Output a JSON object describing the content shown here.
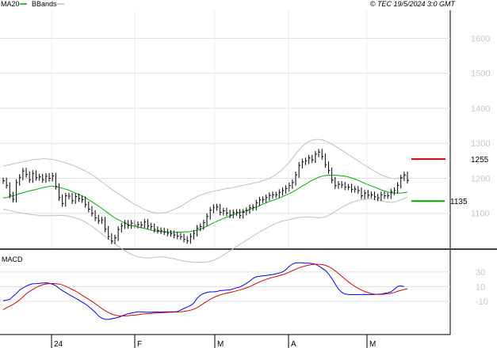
{
  "header": {
    "timestamp": "© TEC 19/5/2024 3:0 GMT"
  },
  "price_panel": {
    "legend": [
      {
        "label": "MA20",
        "color": "#00a000"
      },
      {
        "label": "BBands",
        "color": "#bfbfbf"
      }
    ]
  },
  "macd_panel": {
    "title": "MACD"
  },
  "colors": {
    "price_bar": "#000000",
    "ma20": "#00b000",
    "bbands": "#bfbfbf",
    "resistance": "#d00000",
    "support": "#00a000",
    "macd": "#0000ff",
    "signal": "#e00000",
    "grid": "#e0e0e0",
    "frame": "#000000",
    "axis_label": "#c8c8c8"
  },
  "chart_data": [
    {
      "type": "ohlc",
      "name": "price",
      "ylim": [
        1000,
        1680
      ],
      "y_ticks": [
        1100,
        1200,
        1300,
        1400,
        1500,
        1600
      ],
      "x_labels": [
        "24",
        "F",
        "M",
        "A",
        "M"
      ],
      "x_label_positions": [
        0,
        24,
        49,
        72,
        98
      ],
      "n_bars": 124,
      "close": [
        1193,
        1180,
        1152,
        1140,
        1188,
        1203,
        1221,
        1211,
        1196,
        1214,
        1202,
        1204,
        1196,
        1206,
        1200,
        1207,
        1177,
        1145,
        1128,
        1150,
        1149,
        1136,
        1148,
        1142,
        1139,
        1125,
        1112,
        1100,
        1087,
        1079,
        1081,
        1055,
        1034,
        1021,
        1030,
        1054,
        1064,
        1072,
        1065,
        1072,
        1066,
        1068,
        1067,
        1075,
        1064,
        1062,
        1054,
        1051,
        1050,
        1047,
        1043,
        1042,
        1038,
        1035,
        1033,
        1026,
        1022,
        1034,
        1043,
        1058,
        1062,
        1073,
        1091,
        1109,
        1117,
        1118,
        1103,
        1107,
        1101,
        1095,
        1102,
        1103,
        1094,
        1103,
        1108,
        1116,
        1117,
        1130,
        1138,
        1139,
        1145,
        1151,
        1153,
        1153,
        1160,
        1165,
        1171,
        1179,
        1188,
        1210,
        1237,
        1247,
        1250,
        1258,
        1253,
        1269,
        1275,
        1262,
        1239,
        1222,
        1195,
        1179,
        1183,
        1181,
        1175,
        1175,
        1168,
        1169,
        1165,
        1150,
        1158,
        1152,
        1153,
        1147,
        1144,
        1153,
        1150,
        1150,
        1161,
        1165,
        1180,
        1201,
        1210,
        1194
      ],
      "ma20": [
        1144,
        1145,
        1148,
        1150,
        1153,
        1156,
        1159,
        1161,
        1164,
        1166,
        1168,
        1171,
        1173,
        1175,
        1177,
        1178,
        1176,
        1174,
        1172,
        1169,
        1166,
        1162,
        1158,
        1154,
        1150,
        1145,
        1139,
        1133,
        1127,
        1121,
        1114,
        1107,
        1100,
        1093,
        1087,
        1082,
        1077,
        1072,
        1068,
        1065,
        1063,
        1061,
        1059,
        1057,
        1055,
        1052,
        1050,
        1049,
        1048,
        1047,
        1047,
        1047,
        1046,
        1046,
        1046,
        1047,
        1047,
        1048,
        1050,
        1052,
        1055,
        1059,
        1063,
        1068,
        1073,
        1077,
        1081,
        1085,
        1089,
        1092,
        1096,
        1099,
        1102,
        1105,
        1108,
        1111,
        1115,
        1118,
        1122,
        1126,
        1130,
        1134,
        1137,
        1140,
        1144,
        1148,
        1152,
        1156,
        1161,
        1166,
        1172,
        1178,
        1183,
        1189,
        1194,
        1199,
        1203,
        1206,
        1208,
        1209,
        1209,
        1209,
        1208,
        1207,
        1206,
        1204,
        1201,
        1198,
        1194,
        1190,
        1186,
        1182,
        1178,
        1175,
        1171,
        1167,
        1164,
        1161,
        1159,
        1158,
        1158,
        1158,
        1159,
        1161
      ],
      "bb_upper": [
        1235,
        1237,
        1239,
        1241,
        1243,
        1245,
        1247,
        1249,
        1251,
        1253,
        1254,
        1255,
        1256,
        1256,
        1255,
        1254,
        1252,
        1250,
        1247,
        1244,
        1241,
        1238,
        1234,
        1230,
        1226,
        1221,
        1216,
        1210,
        1204,
        1197,
        1190,
        1183,
        1176,
        1169,
        1162,
        1156,
        1150,
        1144,
        1138,
        1132,
        1126,
        1121,
        1116,
        1111,
        1107,
        1104,
        1102,
        1101,
        1101,
        1102,
        1104,
        1107,
        1111,
        1115,
        1120,
        1126,
        1132,
        1138,
        1143,
        1148,
        1152,
        1155,
        1158,
        1161,
        1163,
        1165,
        1167,
        1169,
        1171,
        1172,
        1174,
        1176,
        1178,
        1180,
        1182,
        1184,
        1186,
        1188,
        1190,
        1193,
        1196,
        1200,
        1205,
        1211,
        1218,
        1226,
        1235,
        1246,
        1258,
        1270,
        1281,
        1291,
        1299,
        1305,
        1309,
        1311,
        1311,
        1310,
        1307,
        1303,
        1298,
        1292,
        1286,
        1280,
        1274,
        1268,
        1262,
        1256,
        1250,
        1244,
        1238,
        1232,
        1226,
        1220,
        1215,
        1210,
        1206,
        1203,
        1200,
        1199,
        1200,
        1202,
        1205,
        1208
      ],
      "bb_lower": [
        1112,
        1110,
        1108,
        1106,
        1104,
        1102,
        1100,
        1099,
        1097,
        1096,
        1095,
        1094,
        1093,
        1093,
        1093,
        1094,
        1094,
        1094,
        1094,
        1093,
        1092,
        1090,
        1087,
        1084,
        1080,
        1075,
        1069,
        1063,
        1056,
        1049,
        1041,
        1034,
        1027,
        1020,
        1013,
        1006,
        999,
        993,
        988,
        983,
        979,
        976,
        974,
        973,
        973,
        973,
        974,
        975,
        976,
        975,
        974,
        972,
        970,
        968,
        966,
        964,
        962,
        961,
        960,
        960,
        960,
        960,
        961,
        963,
        966,
        970,
        975,
        981,
        987,
        993,
        999,
        1005,
        1011,
        1017,
        1023,
        1029,
        1035,
        1041,
        1047,
        1052,
        1057,
        1062,
        1067,
        1071,
        1075,
        1078,
        1080,
        1082,
        1084,
        1086,
        1088,
        1089,
        1090,
        1090,
        1089,
        1088,
        1087,
        1088,
        1090,
        1094,
        1099,
        1105,
        1111,
        1117,
        1122,
        1127,
        1131,
        1134,
        1137,
        1139,
        1140,
        1141,
        1141,
        1140,
        1138,
        1136,
        1134,
        1132,
        1131,
        1132,
        1135,
        1139,
        1142,
        1146
      ],
      "annotations": [
        {
          "label": "1255",
          "value": 1255,
          "color": "#d00000"
        },
        {
          "label": "1135",
          "value": 1135,
          "color": "#00a000"
        }
      ]
    },
    {
      "type": "line",
      "name": "MACD",
      "ylim": [
        -55,
        60
      ],
      "y_ticks": [
        30,
        10,
        -10
      ],
      "y_tick_labels": [
        "30",
        "10",
        "-10"
      ],
      "series": [
        {
          "name": "MACD",
          "color": "#0000ff",
          "values": [
            -9.0,
            -8.2,
            -7.3,
            -3.2,
            0.7,
            5.4,
            8.4,
            10.8,
            12.7,
            14.0,
            14.2,
            14.5,
            15.0,
            15.3,
            14.8,
            13.4,
            11.4,
            7.9,
            4.8,
            2.2,
            -0.5,
            -3.1,
            -5.6,
            -8.0,
            -10.8,
            -13.5,
            -16.8,
            -20.7,
            -24.8,
            -29.6,
            -32.6,
            -34.3,
            -34.5,
            -33.5,
            -32.6,
            -31.8,
            -30.0,
            -28.2,
            -26.6,
            -25.7,
            -24.9,
            -24.2,
            -24.1,
            -24.5,
            -24.6,
            -24.7,
            -24.5,
            -24.4,
            -24.3,
            -24.1,
            -24.1,
            -24.1,
            -24.0,
            -23.7,
            -21.8,
            -19.5,
            -17.6,
            -15.6,
            -12.3,
            -5.8,
            -1.5,
            0.8,
            2.3,
            3.0,
            3.1,
            3.5,
            4.8,
            5.1,
            5.5,
            5.7,
            7.0,
            8.6,
            9.6,
            11.9,
            14.5,
            17.6,
            21.3,
            23.6,
            24.1,
            24.9,
            25.2,
            26.0,
            26.6,
            27.7,
            28.6,
            30.1,
            33.1,
            37.5,
            40.8,
            42.5,
            42.6,
            42.5,
            42.1,
            42.0,
            41.5,
            40.6,
            38.2,
            35.2,
            32.3,
            27.3,
            21.3,
            13.9,
            7.0,
            2.4,
            0.2,
            -0.6,
            -0.7,
            -0.7,
            -0.7,
            -0.6,
            -0.5,
            -0.6,
            -0.6,
            -0.6,
            -0.1,
            -0.1,
            1.0,
            1.8,
            3.1,
            6.4,
            10.4,
            11.1,
            10.3
          ]
        },
        {
          "name": "Signal",
          "color": "#e00000",
          "values": [
            -21.2,
            -18.7,
            -16.4,
            -14.2,
            -11.3,
            -7.8,
            -3.9,
            0.4,
            3.6,
            6.4,
            8.8,
            11.0,
            12.7,
            13.7,
            14.2,
            14.3,
            14.2,
            13.6,
            12.5,
            10.7,
            8.6,
            6.3,
            4.0,
            1.4,
            -1.5,
            -4.3,
            -7.1,
            -10.0,
            -13.0,
            -16.2,
            -19.5,
            -22.4,
            -25.0,
            -27.1,
            -28.6,
            -29.4,
            -29.8,
            -29.7,
            -29.5,
            -29.0,
            -28.6,
            -28.0,
            -27.4,
            -27.0,
            -26.5,
            -26.2,
            -25.9,
            -25.7,
            -25.4,
            -25.1,
            -24.9,
            -24.7,
            -24.5,
            -24.3,
            -24.1,
            -23.6,
            -22.9,
            -21.9,
            -20.4,
            -18.3,
            -15.7,
            -12.8,
            -9.9,
            -7.1,
            -4.7,
            -2.8,
            -1.2,
            0.2,
            1.3,
            2.3,
            3.3,
            4.4,
            5.5,
            6.9,
            8.4,
            10.2,
            12.3,
            14.5,
            16.5,
            18.3,
            20.0,
            21.4,
            22.7,
            23.9,
            25.1,
            26.2,
            27.8,
            29.7,
            31.8,
            33.8,
            35.6,
            37.1,
            38.4,
            39.4,
            40.2,
            40.6,
            40.6,
            40.2,
            39.2,
            37.4,
            34.9,
            31.7,
            28.0,
            24.2,
            20.4,
            16.8,
            13.4,
            10.4,
            7.7,
            5.5,
            3.6,
            2.0,
            0.7,
            -0.2,
            -0.5,
            -0.4,
            -0.1,
            0.4,
            1.1,
            2.2,
            3.7,
            5.1,
            6.3,
            7.2
          ]
        }
      ]
    }
  ]
}
